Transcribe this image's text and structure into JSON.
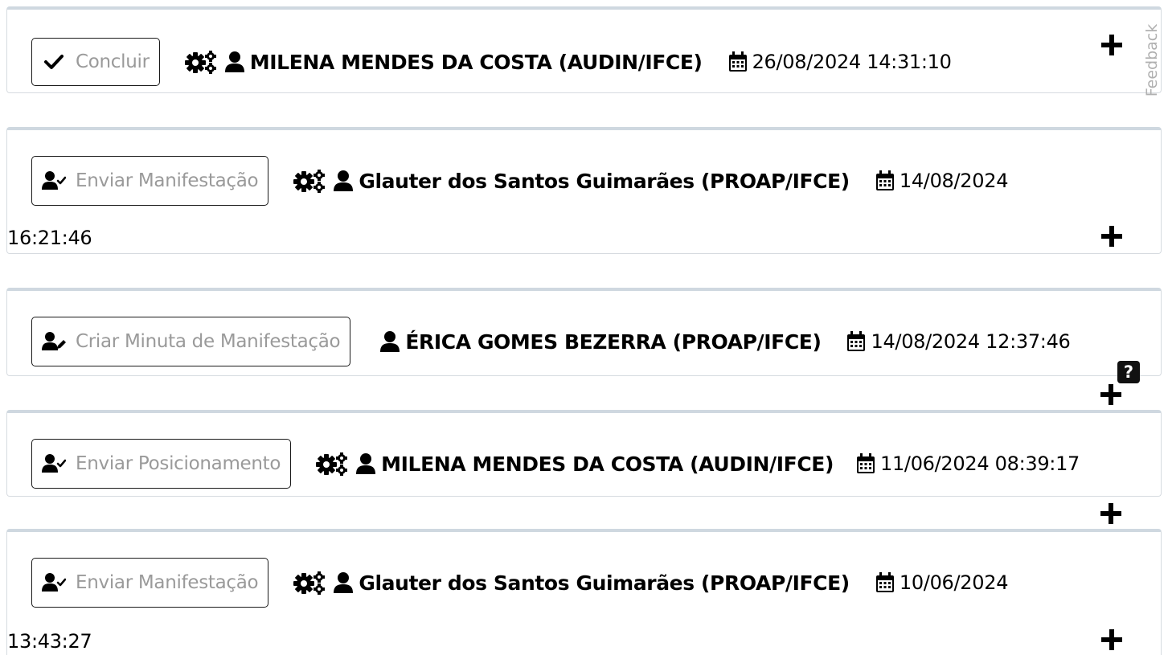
{
  "feedback_label": "Feedback",
  "help_label": "?",
  "entries": [
    {
      "action": "Concluir",
      "author": "MILENA MENDES DA COSTA (AUDIN/IFCE)",
      "date": "26/08/2024 14:31:10"
    },
    {
      "action": "Enviar Manifestação",
      "author": "Glauter dos Santos Guimarães (PROAP/IFCE)",
      "date": "14/08/2024",
      "time": "16:21:46"
    },
    {
      "action": "Criar Minuta de Manifestação",
      "author": "ÉRICA GOMES BEZERRA (PROAP/IFCE)",
      "date": "14/08/2024 12:37:46"
    },
    {
      "action": "Enviar Posicionamento",
      "author": "MILENA MENDES DA COSTA (AUDIN/IFCE)",
      "date": "11/06/2024 08:39:17"
    },
    {
      "action": "Enviar Manifestação",
      "author": "Glauter dos Santos Guimarães (PROAP/IFCE)",
      "date": "10/06/2024",
      "time": "13:43:27"
    }
  ]
}
